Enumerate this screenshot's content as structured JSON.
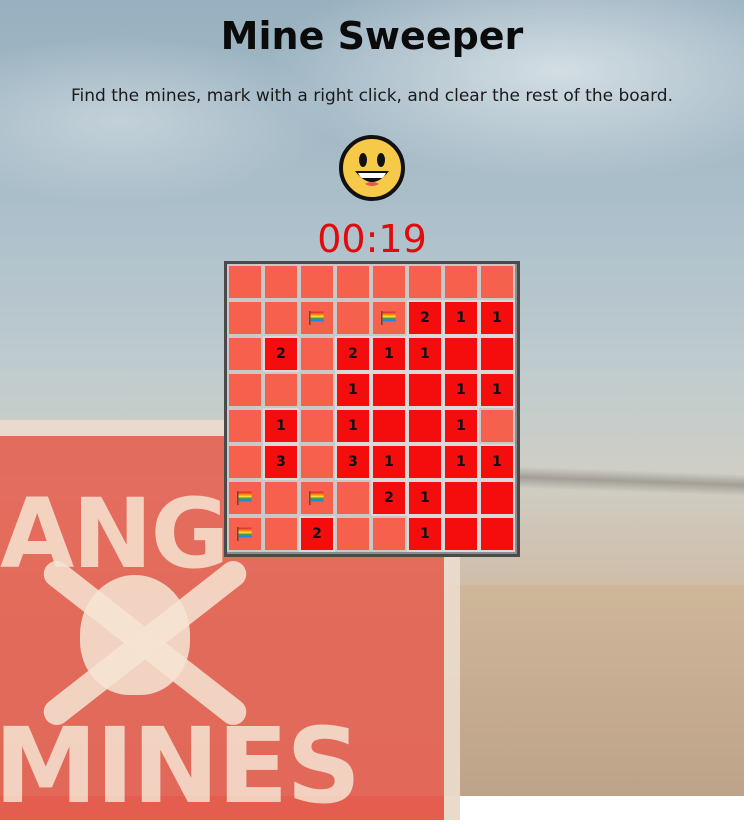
{
  "header": {
    "title": "Mine Sweeper",
    "instructions": "Find the mines, mark with a right click, and clear the rest of the board."
  },
  "status": {
    "face_icon": "smiley-face-icon",
    "timer": "00:19"
  },
  "background_sign": {
    "line1": "ANG",
    "line2": "MINES"
  },
  "board": {
    "rows": 8,
    "cols": 8,
    "cells": [
      [
        "H",
        "H",
        "H",
        "H",
        "H",
        "H",
        "H",
        "H"
      ],
      [
        "H",
        "H",
        "F",
        "H",
        "F",
        "2",
        "1",
        "1"
      ],
      [
        "H",
        "2",
        "H",
        "2",
        "1",
        "1",
        "R",
        "R"
      ],
      [
        "H",
        "H",
        "H",
        "1",
        "R",
        "R",
        "1",
        "1"
      ],
      [
        "H",
        "1",
        "H",
        "1",
        "R",
        "R",
        "1",
        "H"
      ],
      [
        "H",
        "3",
        "H",
        "3",
        "1",
        "R",
        "1",
        "1"
      ],
      [
        "F",
        "H",
        "F",
        "H",
        "2",
        "1",
        "R",
        "R"
      ],
      [
        "F",
        "H",
        "2",
        "H",
        "H",
        "1",
        "R",
        "R"
      ]
    ],
    "legend": {
      "H": "hidden",
      "R": "revealed-empty",
      "F": "flagged",
      "digit": "revealed-number"
    }
  },
  "colors": {
    "hidden_cell": "#f5614d",
    "revealed_cell": "#f50c0c",
    "timer": "#e10b0b",
    "face": "#f7c948"
  }
}
